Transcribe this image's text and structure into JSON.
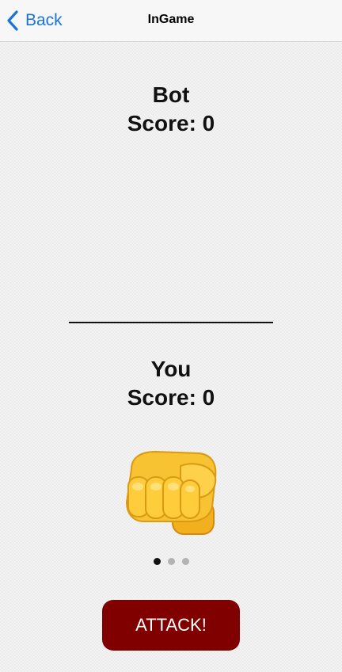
{
  "navbar": {
    "back_label": "Back",
    "title": "InGame"
  },
  "bot": {
    "name": "Bot",
    "score_text": "Score: 0"
  },
  "player": {
    "name": "You",
    "score_text": "Score: 0"
  },
  "selected_move_icon": "fist-icon",
  "pager": {
    "count": 3,
    "active_index": 0
  },
  "attack_button": {
    "label": "ATTACK!"
  },
  "colors": {
    "accent": "#1a73d9",
    "attack_button_bg": "#800000"
  }
}
